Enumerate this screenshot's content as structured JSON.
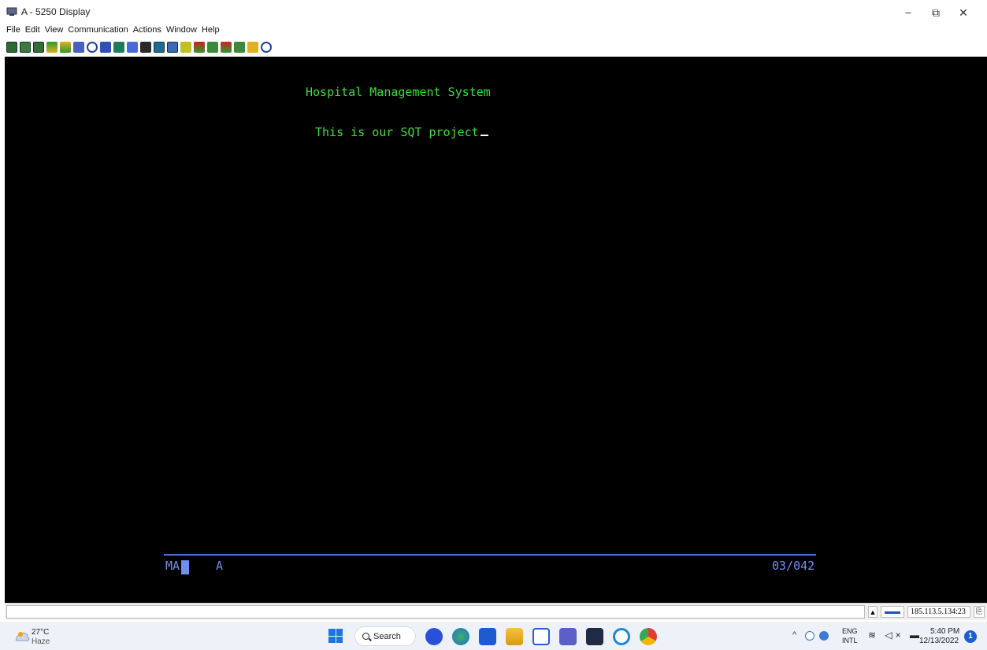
{
  "window": {
    "title": "A - 5250 Display",
    "minimize_glyph": "−",
    "maximize_glyph": "⧉",
    "close_glyph": "✕"
  },
  "menu": [
    "File",
    "Edit",
    "View",
    "Communication",
    "Actions",
    "Window",
    "Help"
  ],
  "toolbar": {
    "icons": [
      "copy-icon",
      "paste-icon",
      "paste-special-icon",
      "send-file-icon",
      "receive-file-icon",
      "print-icon",
      "stop-icon",
      "macro-icon",
      "record-icon",
      "play-icon",
      "keyboard-icon",
      "color-icon",
      "popup-keypad-icon",
      "settings-icon",
      "transfer-up-icon",
      "transfer-down-icon",
      "transfer-up2-icon",
      "transfer-down2-icon",
      "script-icon",
      "help-icon"
    ]
  },
  "terminal": {
    "line1": "Hospital Management System",
    "line2": "This is our SQT project",
    "oia_mode": "MA",
    "oia_field": "A",
    "cursor_position": "03/042",
    "colors": {
      "text": "#3ddc3d",
      "oia": "#6f8ff0",
      "background": "#000000"
    }
  },
  "statusbar": {
    "arrow_glyph": "▲",
    "address": "185.113.5.134:23"
  },
  "taskbar": {
    "weather_temp": "27°C",
    "weather_desc": "Haze",
    "search_label": "Search",
    "tray_up_glyph": "^",
    "lang_line1": "ENG",
    "lang_line2": "INTL",
    "sys_icons_glyphs": "≋ ◁× ▬",
    "time": "5:40 PM",
    "date": "12/13/2022",
    "notification_count": "1"
  }
}
